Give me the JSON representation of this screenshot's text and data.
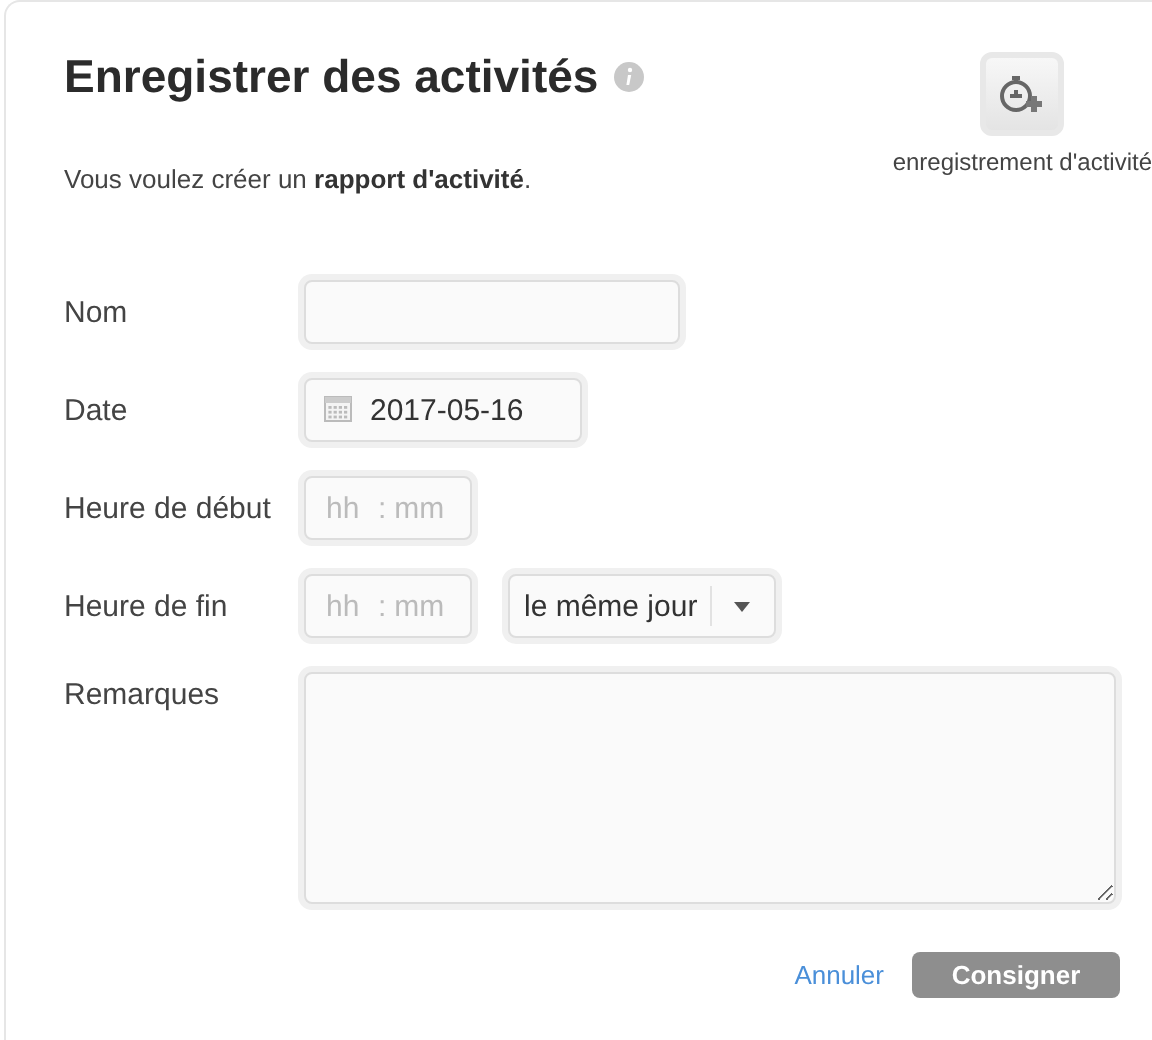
{
  "header": {
    "title": "Enregistrer des activités",
    "description": "Vous voulez créer un **rapport d'activité**.",
    "shortcut": {
      "label": "enregistrement d'activité"
    }
  },
  "form": {
    "fields": [
      {
        "kind": "text",
        "label": "Nom"
      },
      {
        "kind": "date",
        "label": "Date",
        "value": "2017-05-16"
      },
      {
        "kind": "time",
        "label": "Heure de début",
        "hour_placeholder": "hh",
        "separator": ":",
        "minute_placeholder": "mm"
      },
      {
        "kind": "time",
        "label": "Heure de fin",
        "hour_placeholder": "hh",
        "separator": ":",
        "minute_placeholder": "mm",
        "day_select": "le même jour"
      },
      {
        "kind": "textarea",
        "label": "Remarques"
      }
    ]
  },
  "actions": {
    "cancel": "Annuler",
    "submit": "Consigner"
  }
}
